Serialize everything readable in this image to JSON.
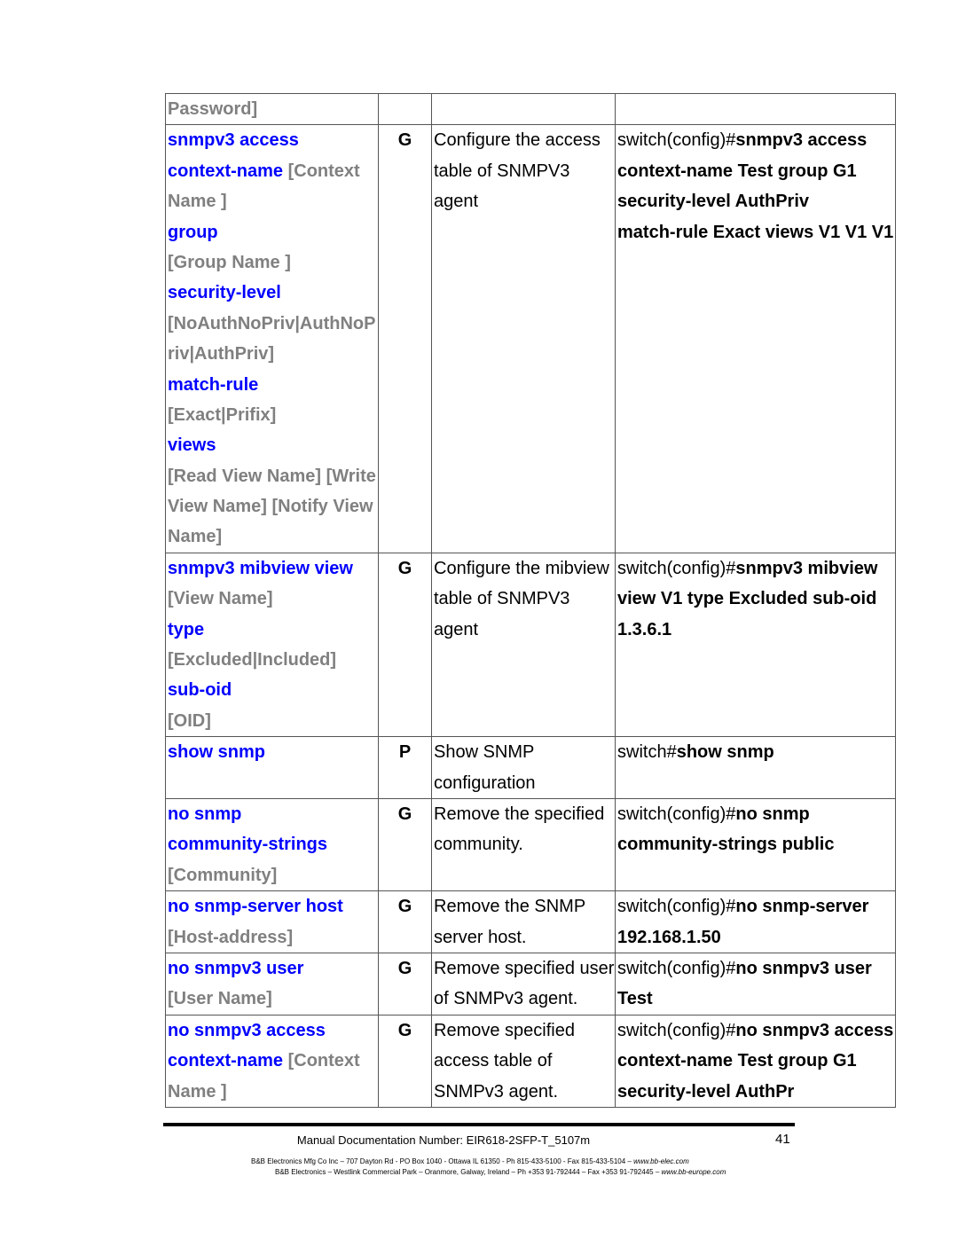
{
  "rows": [
    {
      "cmd": [
        [
          [
            "Password]",
            "g"
          ]
        ]
      ],
      "perm": "",
      "desc": [],
      "example": []
    },
    {
      "cmd": [
        [
          [
            "snmpv3 access",
            "b"
          ]
        ],
        [
          [
            "context-name",
            "b"
          ],
          [
            " [Context",
            "g"
          ]
        ],
        [
          [
            "Name ]",
            "g"
          ]
        ],
        [
          [
            "group",
            "b"
          ]
        ],
        [
          [
            "[Group Name ]",
            "g"
          ]
        ],
        [
          [
            "security-level",
            "b"
          ]
        ],
        [
          [
            "[NoAuthNoPriv|AuthNoP",
            "g"
          ]
        ],
        [
          [
            "riv|AuthPriv]",
            "g"
          ]
        ],
        [
          [
            "match-rule",
            "b"
          ]
        ],
        [
          [
            "[Exact|Prifix]",
            "g"
          ]
        ],
        [
          [
            "views",
            "b"
          ]
        ],
        [
          [
            "[Read View Name] [Write",
            "g"
          ]
        ],
        [
          [
            "View Name] [Notify View",
            "g"
          ]
        ],
        [
          [
            "Name]",
            "g"
          ]
        ]
      ],
      "perm": "G",
      "desc": [
        "Configure the access",
        "table of SNMPV3",
        "agent"
      ],
      "example": [
        [
          [
            "switch(config)#",
            "n"
          ],
          [
            "snmpv3 access",
            "k"
          ]
        ],
        [
          [
            "context-name Test group G1",
            "k"
          ]
        ],
        [
          [
            "security-level AuthPriv",
            "k"
          ]
        ],
        [
          [
            "match-rule Exact views V1 V1 V1",
            "k"
          ]
        ]
      ]
    },
    {
      "cmd": [
        [
          [
            "snmpv3 mibview view",
            "b"
          ]
        ],
        [
          [
            "[View Name]",
            "g"
          ]
        ],
        [
          [
            "type",
            "b"
          ]
        ],
        [
          [
            "[Excluded|Included]",
            "g"
          ]
        ],
        [
          [
            "sub-oid",
            "b"
          ]
        ],
        [
          [
            "[OID]",
            "g"
          ]
        ]
      ],
      "perm": "G",
      "desc": [
        "Configure the mibview",
        "table of SNMPV3",
        "agent"
      ],
      "example": [
        [
          [
            "switch(config)#",
            "n"
          ],
          [
            "snmpv3 mibview",
            "k"
          ]
        ],
        [
          [
            "view V1 type Excluded sub-oid",
            "k"
          ]
        ],
        [
          [
            "1.3.6.1",
            "k"
          ]
        ]
      ]
    },
    {
      "cmd": [
        [
          [
            "show snmp",
            "b"
          ]
        ]
      ],
      "perm": "P",
      "desc": [
        "Show SNMP",
        "configuration"
      ],
      "example": [
        [
          [
            "switch#",
            "n"
          ],
          [
            "show snmp",
            "k"
          ]
        ]
      ]
    },
    {
      "cmd": [
        [
          [
            "no snmp",
            "b"
          ]
        ],
        [
          [
            "community-strings",
            "b"
          ]
        ],
        [
          [
            "[Community]",
            "g"
          ]
        ]
      ],
      "perm": "G",
      "desc": [
        "Remove the specified",
        "community."
      ],
      "example": [
        [
          [
            "switch(config)#",
            "n"
          ],
          [
            "no snmp",
            "k"
          ]
        ],
        [
          [
            "community-strings public",
            "k"
          ]
        ]
      ]
    },
    {
      "cmd": [
        [
          [
            "no snmp-server host",
            "b"
          ]
        ],
        [
          [
            "[Host-address]",
            "g"
          ]
        ]
      ],
      "perm": "G",
      "desc": [
        "Remove the SNMP",
        "server host."
      ],
      "example": [
        [
          [
            "switch(config)#",
            "n"
          ],
          [
            "no snmp-server",
            "k"
          ]
        ],
        [
          [
            "192.168.1.50",
            "k"
          ]
        ]
      ]
    },
    {
      "cmd": [
        [
          [
            "no snmpv3 user",
            "b"
          ]
        ],
        [
          [
            "[User Name]",
            "g"
          ]
        ]
      ],
      "perm": "G",
      "desc": [
        "Remove specified user",
        "of SNMPv3 agent."
      ],
      "example": [
        [
          [
            "switch(config)#",
            "n"
          ],
          [
            "no snmpv3 user",
            "k"
          ]
        ],
        [
          [
            "Test",
            "k"
          ]
        ]
      ]
    },
    {
      "cmd": [
        [
          [
            "no snmpv3 access",
            "b"
          ]
        ],
        [
          [
            "context-name",
            "b"
          ],
          [
            " [Context",
            "g"
          ]
        ],
        [
          [
            "Name ]",
            "g"
          ]
        ]
      ],
      "perm": "G",
      "desc": [
        "Remove specified",
        "access table of",
        "SNMPv3 agent."
      ],
      "example": [
        [
          [
            "switch(config)#",
            "n"
          ],
          [
            "no snmpv3 access",
            "k"
          ]
        ],
        [
          [
            "context-name Test group G1",
            "k"
          ]
        ],
        [
          [
            "security-level AuthPr",
            "k"
          ]
        ]
      ]
    }
  ],
  "row_heights_lines": [
    1,
    14,
    6,
    2,
    3,
    2,
    2,
    3
  ],
  "footer": {
    "doc_number": "Manual Documentation Number: EIR618-2SFP-T_5107m",
    "page": "41",
    "addr1": "B&B Electronics Mfg Co Inc – 707 Dayton Rd - PO Box 1040 - Ottawa IL 61350 - Ph 815-433-5100 - Fax 815-433-5104 – ",
    "web1": "www.bb-elec.com",
    "addr2": "B&B Electronics – Westlink Commercial Park – Oranmore, Galway, Ireland – Ph +353 91-792444 – Fax +353 91-792445 – ",
    "web2": "www.bb-europe.com"
  },
  "colors": {
    "keyword": "#0000ff",
    "parameter": "#808080"
  }
}
